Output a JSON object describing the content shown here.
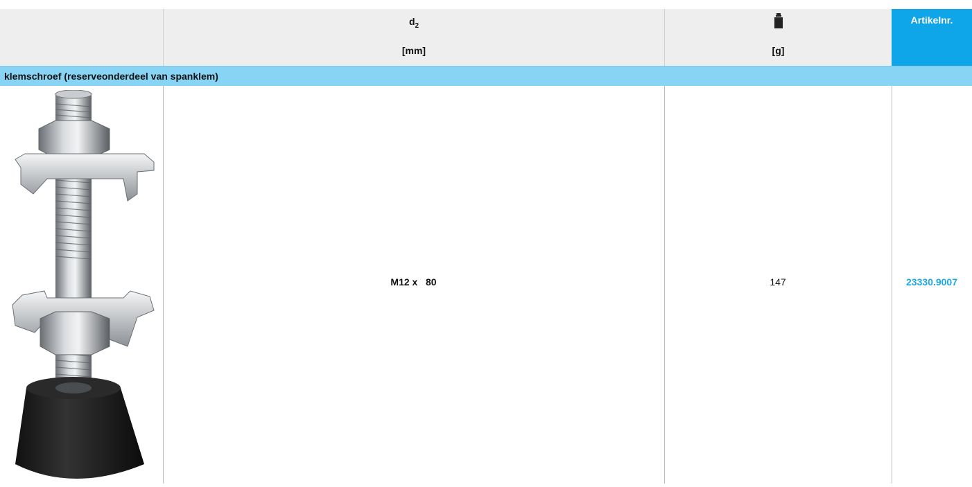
{
  "header": {
    "dim_symbol": "d",
    "dim_subscript": "2",
    "dim_unit": "[mm]",
    "weight_icon": "weight-icon",
    "weight_unit": "[g]",
    "article_label": "Artikelnr."
  },
  "section": {
    "title": "klemschroef (reserveonderdeel van spanklem)"
  },
  "rows": [
    {
      "product_image": "clamp-screw-image",
      "dimension": "M12 x   80",
      "weight": "147",
      "article_no": "23330.9007"
    }
  ],
  "colors": {
    "header_bg": "#eeeeee",
    "article_header_bg": "#0ea5e9",
    "section_bg": "#87d4f4",
    "article_link": "#1ca9e6"
  }
}
